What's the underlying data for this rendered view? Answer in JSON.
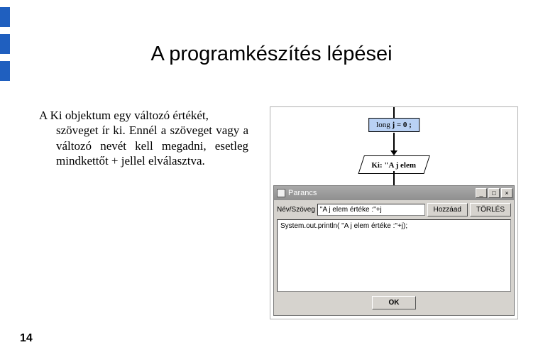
{
  "title": "A programkészítés lépései",
  "paragraph_first": "A Ki objektum egy változó értékét,",
  "paragraph_rest": "szöveget ír ki. Ennél a szöveget vagy a változó nevét kell megadni, esetleg mindkettőt + jellel elválasztva.",
  "page_number": "14",
  "flow": {
    "box1_pre": "long ",
    "box1_code": "j = 0 ;",
    "parallelogram_pre": "Ki: ",
    "parallelogram_text": "\"A j elem"
  },
  "window": {
    "title": "Parancs",
    "min_glyph": "_",
    "max_glyph": "□",
    "close_glyph": "×",
    "label_name": "Név/Szöveg",
    "input_value": "\"A j elem értéke :\"+j",
    "btn_add": "Hozzáad",
    "btn_clear": "TÖRLÉS",
    "code_line": "System.out.println( \"A j elem értéke :\"+j);",
    "btn_ok": "OK"
  }
}
